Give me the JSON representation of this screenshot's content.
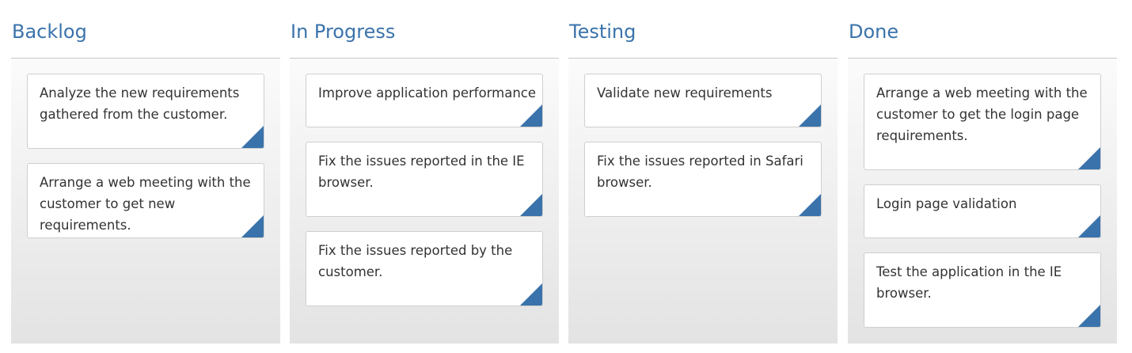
{
  "board": {
    "accent_color": "#3a73ab",
    "columns": [
      {
        "title": "Backlog",
        "cards": [
          {
            "text": "Analyze the new requirements gathered from the customer."
          },
          {
            "text": "Arrange a web meeting with the customer to get new requirements."
          }
        ]
      },
      {
        "title": "In Progress",
        "cards": [
          {
            "text": "Improve application performance"
          },
          {
            "text": "Fix the issues reported in the IE browser."
          },
          {
            "text": "Fix the issues reported by the customer."
          }
        ]
      },
      {
        "title": "Testing",
        "cards": [
          {
            "text": "Validate new requirements"
          },
          {
            "text": "Fix the issues reported in Safari browser."
          }
        ]
      },
      {
        "title": "Done",
        "cards": [
          {
            "text": "Arrange a web meeting with the customer to get the login page requirements."
          },
          {
            "text": "Login page validation"
          },
          {
            "text": "Test the application in the IE browser."
          }
        ]
      }
    ]
  }
}
